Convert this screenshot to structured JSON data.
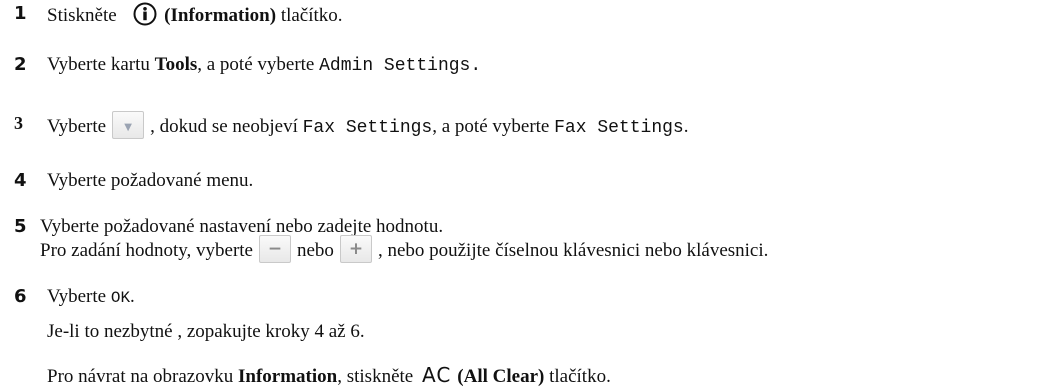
{
  "steps": [
    {
      "num": "1",
      "pre": "Stiskněte",
      "bold": "(Information)",
      "post": "tlačítko."
    },
    {
      "num": "2",
      "pre": "Vyberte kartu",
      "bold": "Tools",
      "mid": ", a poté vyberte",
      "mono": "Admin Settings."
    },
    {
      "num": "3",
      "pre": "Vyberte",
      "mid": ", dokud se neobjeví",
      "mono1": "Fax Settings",
      "mid2": ", a poté vyberte",
      "mono2": "Fax Settings",
      "end": "."
    },
    {
      "num": "4",
      "pre": "Vyberte požadované",
      "mono": "menu."
    },
    {
      "num": "5",
      "line1": "Vyberte požadované nastavení nebo zadejte hodnotu.",
      "line2_pre": "Pro zadání hodnoty, vyberte",
      "line2_mid": "nebo",
      "line2_post": ", nebo použijte číselnou klávesnici nebo klávesnici."
    },
    {
      "num": "6",
      "pre": "Vyberte",
      "mono": "OK",
      "end": "."
    }
  ],
  "note_repeat": "Je-li to nezbytné , zopakujte kroky 4 až 6.",
  "note_return": {
    "pre": "Pro návrat na obrazovku",
    "bold": "Information",
    "mid": ", stiskněte",
    "ac": "AC",
    "bold2": "(All Clear)",
    "post": "tlačítko."
  },
  "icons": {
    "info": "info-icon",
    "down": "scroll-down-button-icon",
    "minus": "minus-button-icon",
    "plus": "plus-button-icon"
  }
}
